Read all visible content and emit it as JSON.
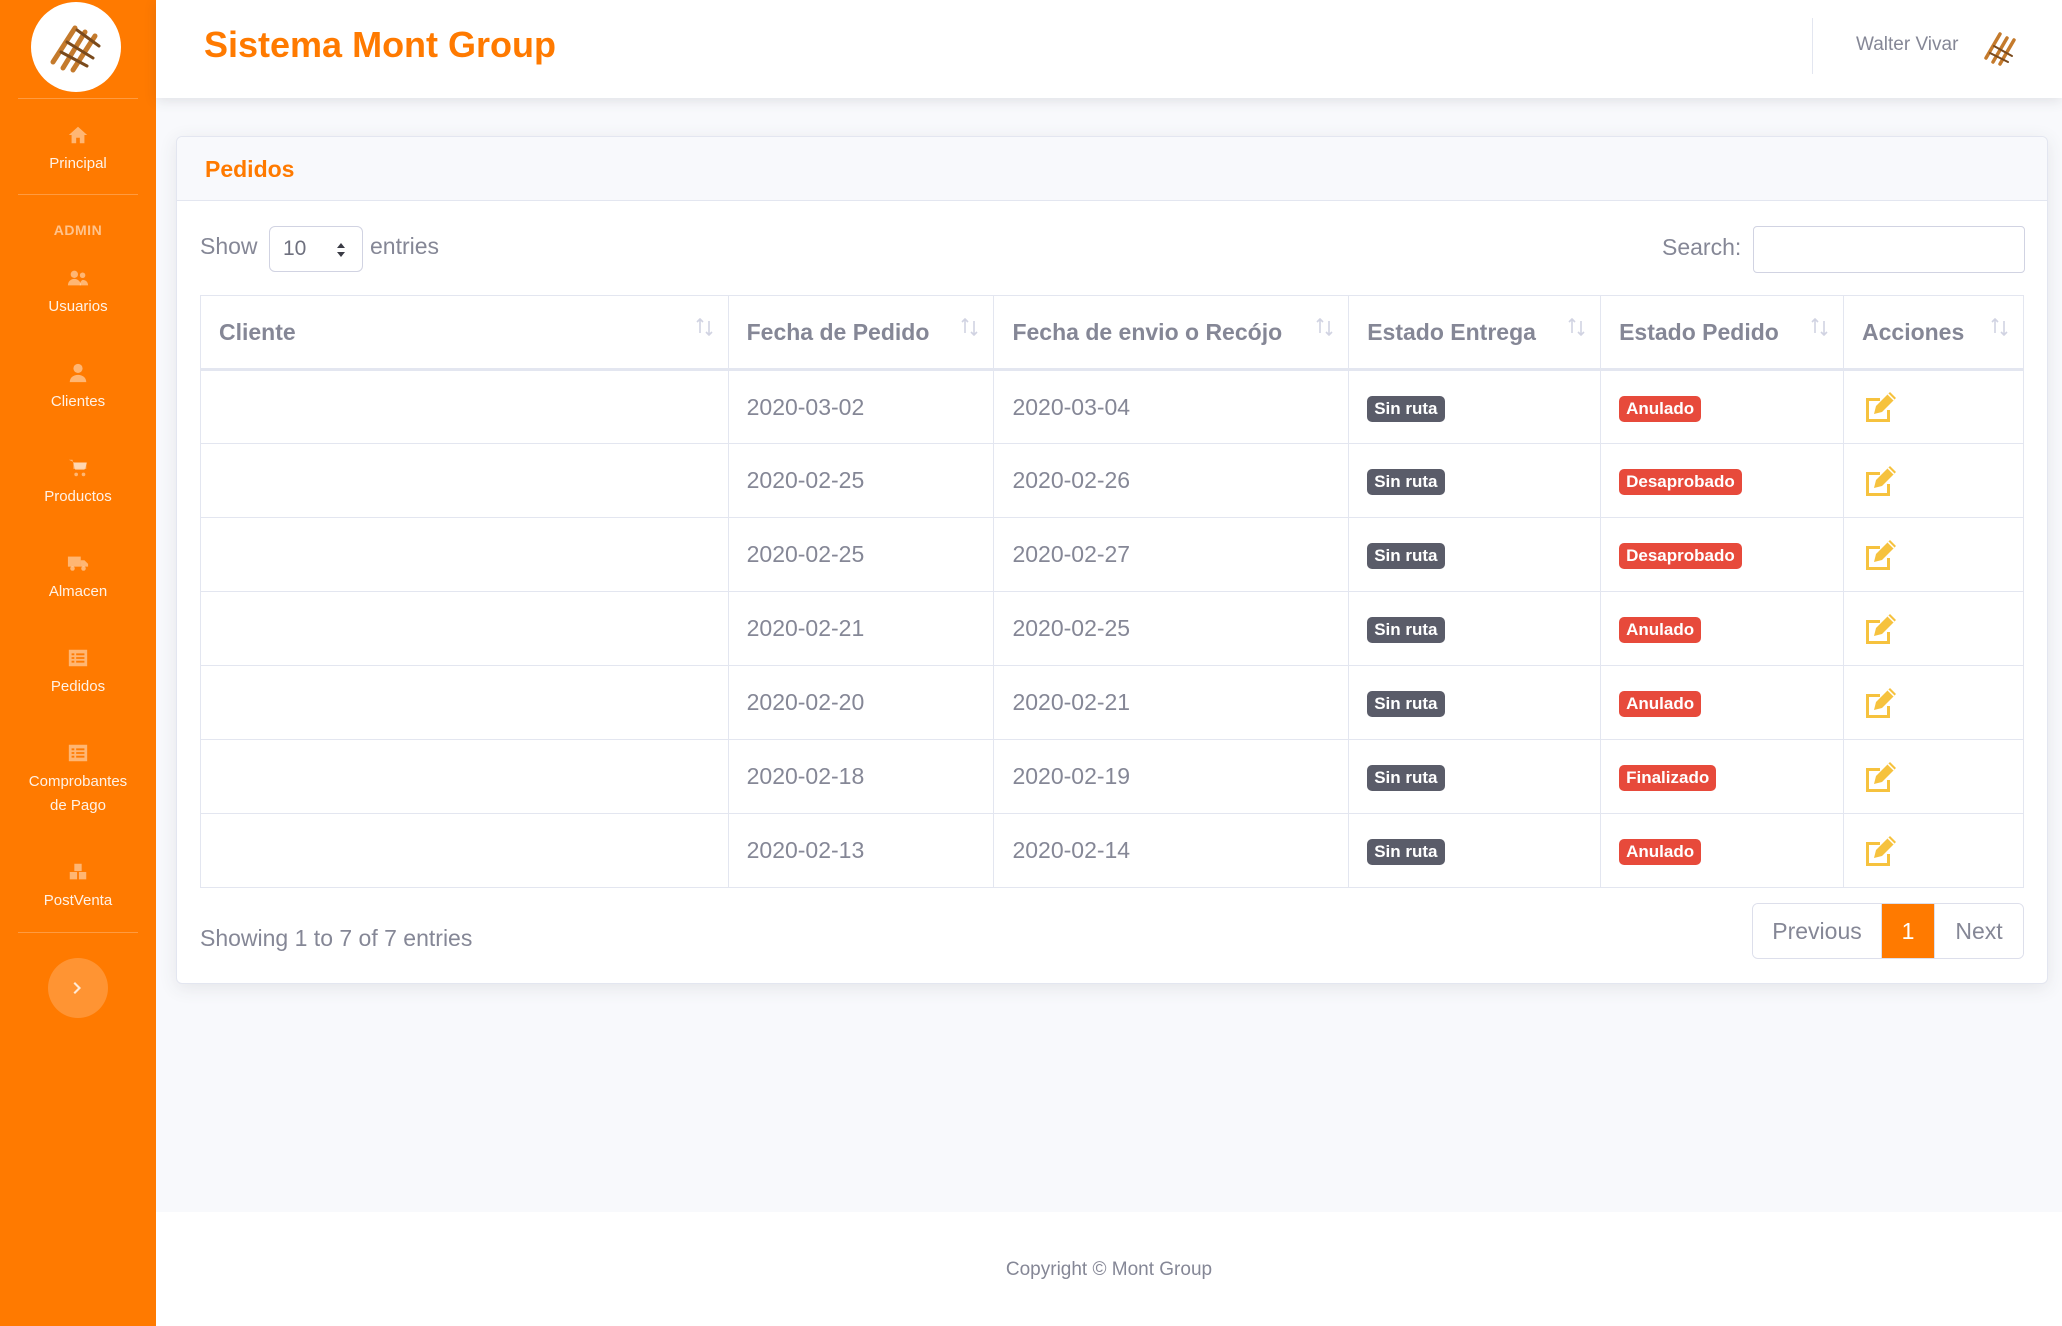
{
  "app": {
    "title": "Sistema Mont Group"
  },
  "user": {
    "name": "Walter Vivar"
  },
  "sidebar": {
    "items": [
      {
        "label": "Principal",
        "icon": "home-icon"
      },
      {
        "label": "Usuarios",
        "icon": "users-icon"
      },
      {
        "label": "Clientes",
        "icon": "user-icon"
      },
      {
        "label": "Productos",
        "icon": "cart-icon"
      },
      {
        "label": "Almacen",
        "icon": "truck-icon"
      },
      {
        "label": "Pedidos",
        "icon": "list-icon"
      },
      {
        "label": "Comprobantes de Pago",
        "icon": "list-icon"
      },
      {
        "label": "PostVenta",
        "icon": "boxes-icon"
      }
    ],
    "heading_admin": "ADMIN"
  },
  "card": {
    "title": "Pedidos"
  },
  "table_controls": {
    "show_label": "Show",
    "entries_label": "entries",
    "length_value": "10",
    "search_label": "Search:",
    "search_value": ""
  },
  "table": {
    "columns": [
      "Cliente",
      "Fecha de Pedido",
      "Fecha de envio o Recójo",
      "Estado Entrega",
      "Estado Pedido",
      "Acciones"
    ],
    "rows": [
      {
        "cliente": "",
        "fecha_pedido": "2020-03-02",
        "fecha_envio": "2020-03-04",
        "estado_entrega": "Sin ruta",
        "estado_pedido": "Anulado"
      },
      {
        "cliente": "",
        "fecha_pedido": "2020-02-25",
        "fecha_envio": "2020-02-26",
        "estado_entrega": "Sin ruta",
        "estado_pedido": "Desaprobado"
      },
      {
        "cliente": "",
        "fecha_pedido": "2020-02-25",
        "fecha_envio": "2020-02-27",
        "estado_entrega": "Sin ruta",
        "estado_pedido": "Desaprobado"
      },
      {
        "cliente": "",
        "fecha_pedido": "2020-02-21",
        "fecha_envio": "2020-02-25",
        "estado_entrega": "Sin ruta",
        "estado_pedido": "Anulado"
      },
      {
        "cliente": "",
        "fecha_pedido": "2020-02-20",
        "fecha_envio": "2020-02-21",
        "estado_entrega": "Sin ruta",
        "estado_pedido": "Anulado"
      },
      {
        "cliente": "",
        "fecha_pedido": "2020-02-18",
        "fecha_envio": "2020-02-19",
        "estado_entrega": "Sin ruta",
        "estado_pedido": "Finalizado"
      },
      {
        "cliente": "",
        "fecha_pedido": "2020-02-13",
        "fecha_envio": "2020-02-14",
        "estado_entrega": "Sin ruta",
        "estado_pedido": "Anulado"
      }
    ]
  },
  "pagination": {
    "info": "Showing 1 to 7 of 7 entries",
    "previous": "Previous",
    "current": "1",
    "next": "Next"
  },
  "footer": {
    "copyright": "Copyright © Mont Group"
  },
  "colors": {
    "brand": "#ff7a00",
    "badge_dark": "#5a5c69",
    "badge_danger": "#e74a3b",
    "edit_icon": "#f6c23e"
  }
}
